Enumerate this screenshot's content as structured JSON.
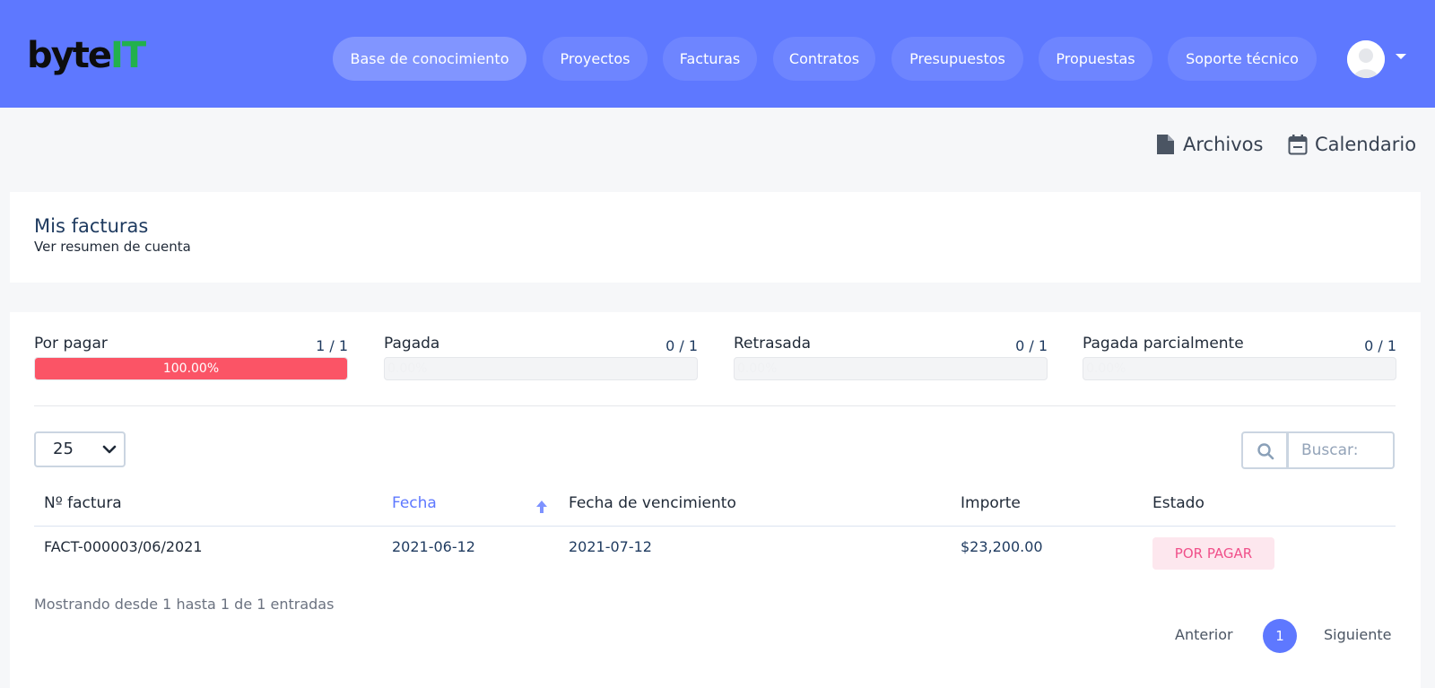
{
  "brand": {
    "logo_part1": "byte",
    "logo_part2": "IT"
  },
  "nav": [
    {
      "label": "Base de conocimiento",
      "active": true
    },
    {
      "label": "Proyectos"
    },
    {
      "label": "Facturas"
    },
    {
      "label": "Contratos"
    },
    {
      "label": "Presupuestos"
    },
    {
      "label": "Propuestas"
    },
    {
      "label": "Soporte técnico"
    }
  ],
  "top_links": {
    "files": "Archivos",
    "calendar": "Calendario"
  },
  "page": {
    "title": "Mis facturas",
    "subtitle": "Ver resumen de cuenta"
  },
  "stats": [
    {
      "label": "Por pagar",
      "count": "1 / 1",
      "percent_label": "100.00%",
      "fill_percent": 100
    },
    {
      "label": "Pagada",
      "count": "0 / 1",
      "percent_label": "0.00%",
      "fill_percent": 0
    },
    {
      "label": "Retrasada",
      "count": "0 / 1",
      "percent_label": "0.00%",
      "fill_percent": 0
    },
    {
      "label": "Pagada parcialmente",
      "count": "0 / 1",
      "percent_label": "0.00%",
      "fill_percent": 0
    }
  ],
  "table": {
    "page_size": "25",
    "search_placeholder": "Buscar:",
    "columns": [
      "Nº factura",
      "Fecha",
      "Fecha de vencimiento",
      "Importe",
      "Estado"
    ],
    "rows": [
      {
        "number": "FACT-000003/06/2021",
        "date": "2021-06-12",
        "due_date": "2021-07-12",
        "amount": "$23,200.00",
        "status": "POR PAGAR"
      }
    ],
    "info": "Mostrando desde 1 hasta 1 de 1 entradas",
    "pagination": {
      "prev": "Anterior",
      "current": "1",
      "next": "Siguiente"
    }
  },
  "colors": {
    "header": "#5e78ff",
    "unpaid_bar": "#fb5466",
    "status_badge_bg": "#fde7ee",
    "status_badge_text": "#f0508a"
  },
  "icons": [
    "user-avatar-icon",
    "file-icon",
    "calendar-icon",
    "search-icon",
    "sort-up-icon",
    "chevron-down-icon"
  ]
}
